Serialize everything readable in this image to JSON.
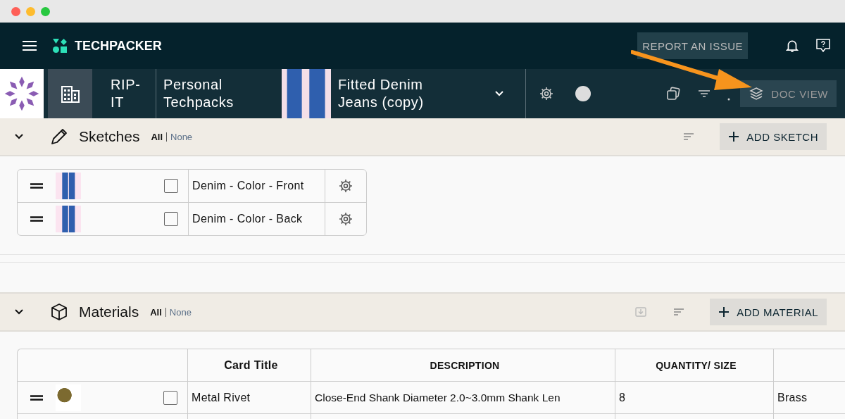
{
  "nav": {
    "logo": "TECHPACKER",
    "report_button": "REPORT AN ISSUE"
  },
  "breadcrumb": {
    "company": "RIP-IT",
    "folder": "Personal Techpacks",
    "product": "Fitted Denim Jeans (copy)"
  },
  "toolbar": {
    "doc_view": "DOC VIEW"
  },
  "sketches": {
    "title": "Sketches",
    "expanded": true,
    "all": "All",
    "none": "None",
    "add_button": "ADD SKETCH",
    "items": [
      {
        "name": "Denim - Color - Front",
        "checked": false
      },
      {
        "name": "Denim - Color - Back",
        "checked": false
      }
    ]
  },
  "materials": {
    "title": "Materials",
    "expanded": true,
    "all": "All",
    "none": "None",
    "add_button": "ADD MATERIAL",
    "columns": [
      "Card Title",
      "DESCRIPTION",
      "QUANTITY/ SIZE"
    ],
    "rows": [
      {
        "title": "Metal Rivet",
        "description": "Close-End  Shank Diameter 2.0~3.0mm Shank Len",
        "quantity": "8",
        "column_5": "Brass",
        "checked": false
      }
    ]
  }
}
